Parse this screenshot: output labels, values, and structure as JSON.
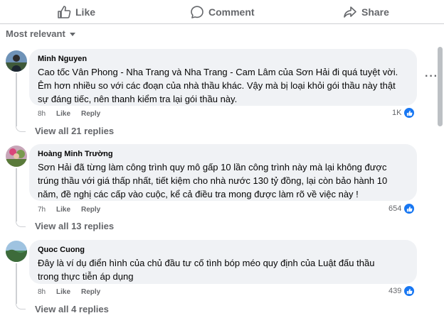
{
  "actions": {
    "like_label": "Like",
    "comment_label": "Comment",
    "share_label": "Share"
  },
  "sort": {
    "label": "Most relevant"
  },
  "comments": [
    {
      "author": "Minh Nguyen",
      "text": "Cao tốc Vân Phong - Nha Trang và Nha Trang - Cam Lâm của Sơn Hải đi quá tuyệt vời.\nÊm hơn nhiều so với các đoạn của nhà thầu khác. Vậy mà bị loại khỏi gói thầu này thật\nsự đáng tiếc, nên thanh kiểm tra lại gói thầu này.",
      "time": "8h",
      "like_label": "Like",
      "reply_label": "Reply",
      "reaction_count": "1K",
      "view_replies": "View all 21 replies"
    },
    {
      "author": "Hoàng Minh Trường",
      "text": "Sơn Hải đã từng làm công trình quy mô gấp 10 lần công trình này mà lại không được\ntrúng thầu với giá thấp nhất, tiết kiệm cho nhà nước 130 tỷ đồng, lại còn bảo hành 10\nnăm, đề nghị các cấp vào cuộc, kể cả điều tra mong được làm rõ về việc này !",
      "time": "7h",
      "like_label": "Like",
      "reply_label": "Reply",
      "reaction_count": "654",
      "view_replies": "View all 13 replies"
    },
    {
      "author": "Quoc Cuong",
      "text": "Đây là ví dụ điển hình của chủ đầu tư cố tình bóp méo quy định của Luật đấu thầu\ntrong thực tiễn áp dụng",
      "time": "8h",
      "like_label": "Like",
      "reply_label": "Reply",
      "reaction_count": "439",
      "view_replies": "View all 4 replies"
    }
  ],
  "colors": {
    "accent": "#1877f2",
    "secondary_text": "#65676b",
    "bubble": "#f0f2f5"
  },
  "icons": [
    "thumbs-up-icon",
    "comment-icon",
    "share-icon",
    "more-icon",
    "like-reaction-icon"
  ]
}
